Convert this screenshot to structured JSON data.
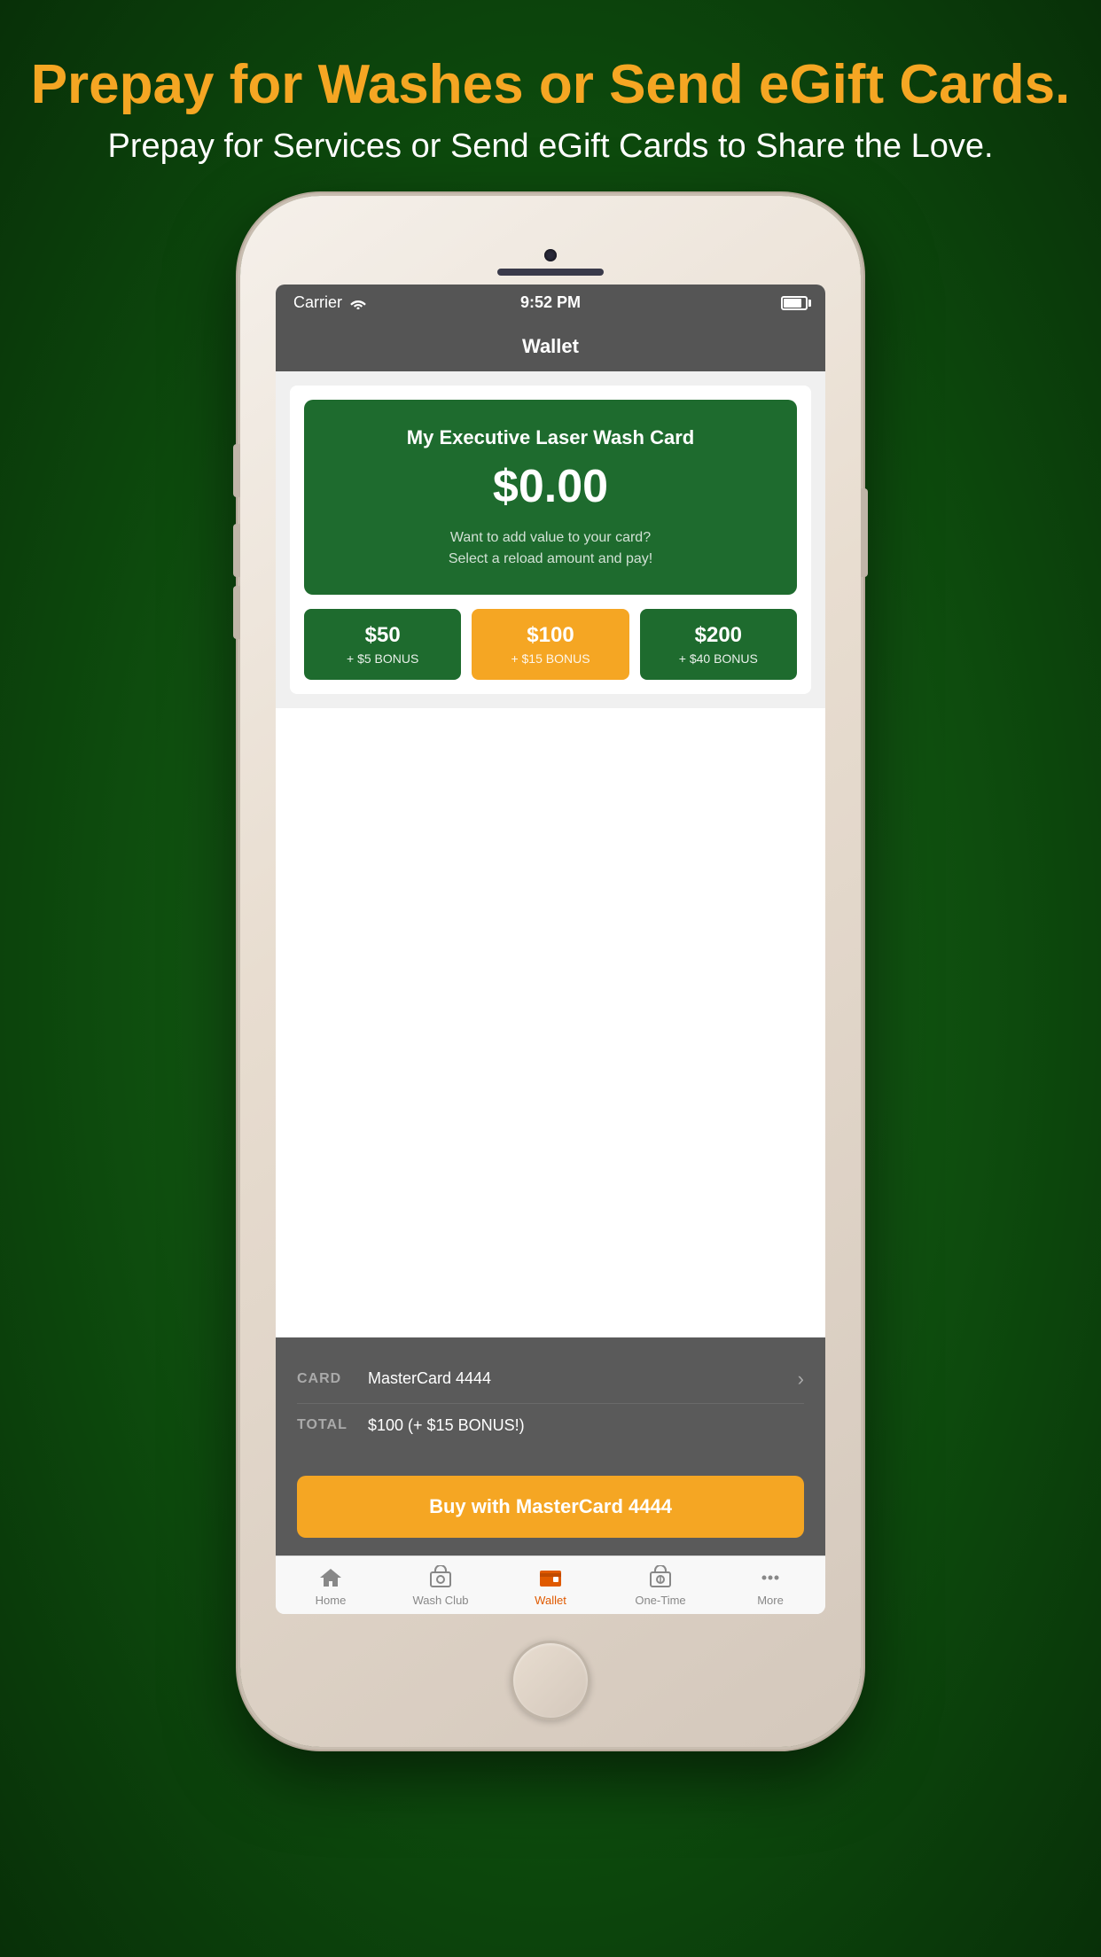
{
  "header": {
    "title": "Prepay for Washes or Send eGift Cards.",
    "subtitle": "Prepay for Services or Send eGift Cards to Share the Love."
  },
  "statusBar": {
    "carrier": "Carrier",
    "time": "9:52 PM"
  },
  "navBar": {
    "title": "Wallet"
  },
  "washCard": {
    "title": "My Executive Laser Wash Card",
    "amount": "$0.00",
    "description_line1": "Want to add value to your card?",
    "description_line2": "Select a reload amount and pay!"
  },
  "amountOptions": [
    {
      "main": "$50",
      "bonus": "+ $5 BONUS",
      "style": "green"
    },
    {
      "main": "$100",
      "bonus": "+ $15 BONUS",
      "style": "orange"
    },
    {
      "main": "$200",
      "bonus": "+ $40 BONUS",
      "style": "green"
    }
  ],
  "payment": {
    "cardLabel": "CARD",
    "cardValue": "MasterCard 4444",
    "totalLabel": "TOTAL",
    "totalValue": "$100 (+ $15 BONUS!)"
  },
  "buyButton": {
    "label": "Buy with MasterCard 4444"
  },
  "tabBar": {
    "items": [
      {
        "label": "Home",
        "id": "home",
        "active": false
      },
      {
        "label": "Wash Club",
        "id": "wash-club",
        "active": false
      },
      {
        "label": "Wallet",
        "id": "wallet",
        "active": true
      },
      {
        "label": "One-Time",
        "id": "one-time",
        "active": false
      },
      {
        "label": "More",
        "id": "more",
        "active": false
      }
    ]
  }
}
